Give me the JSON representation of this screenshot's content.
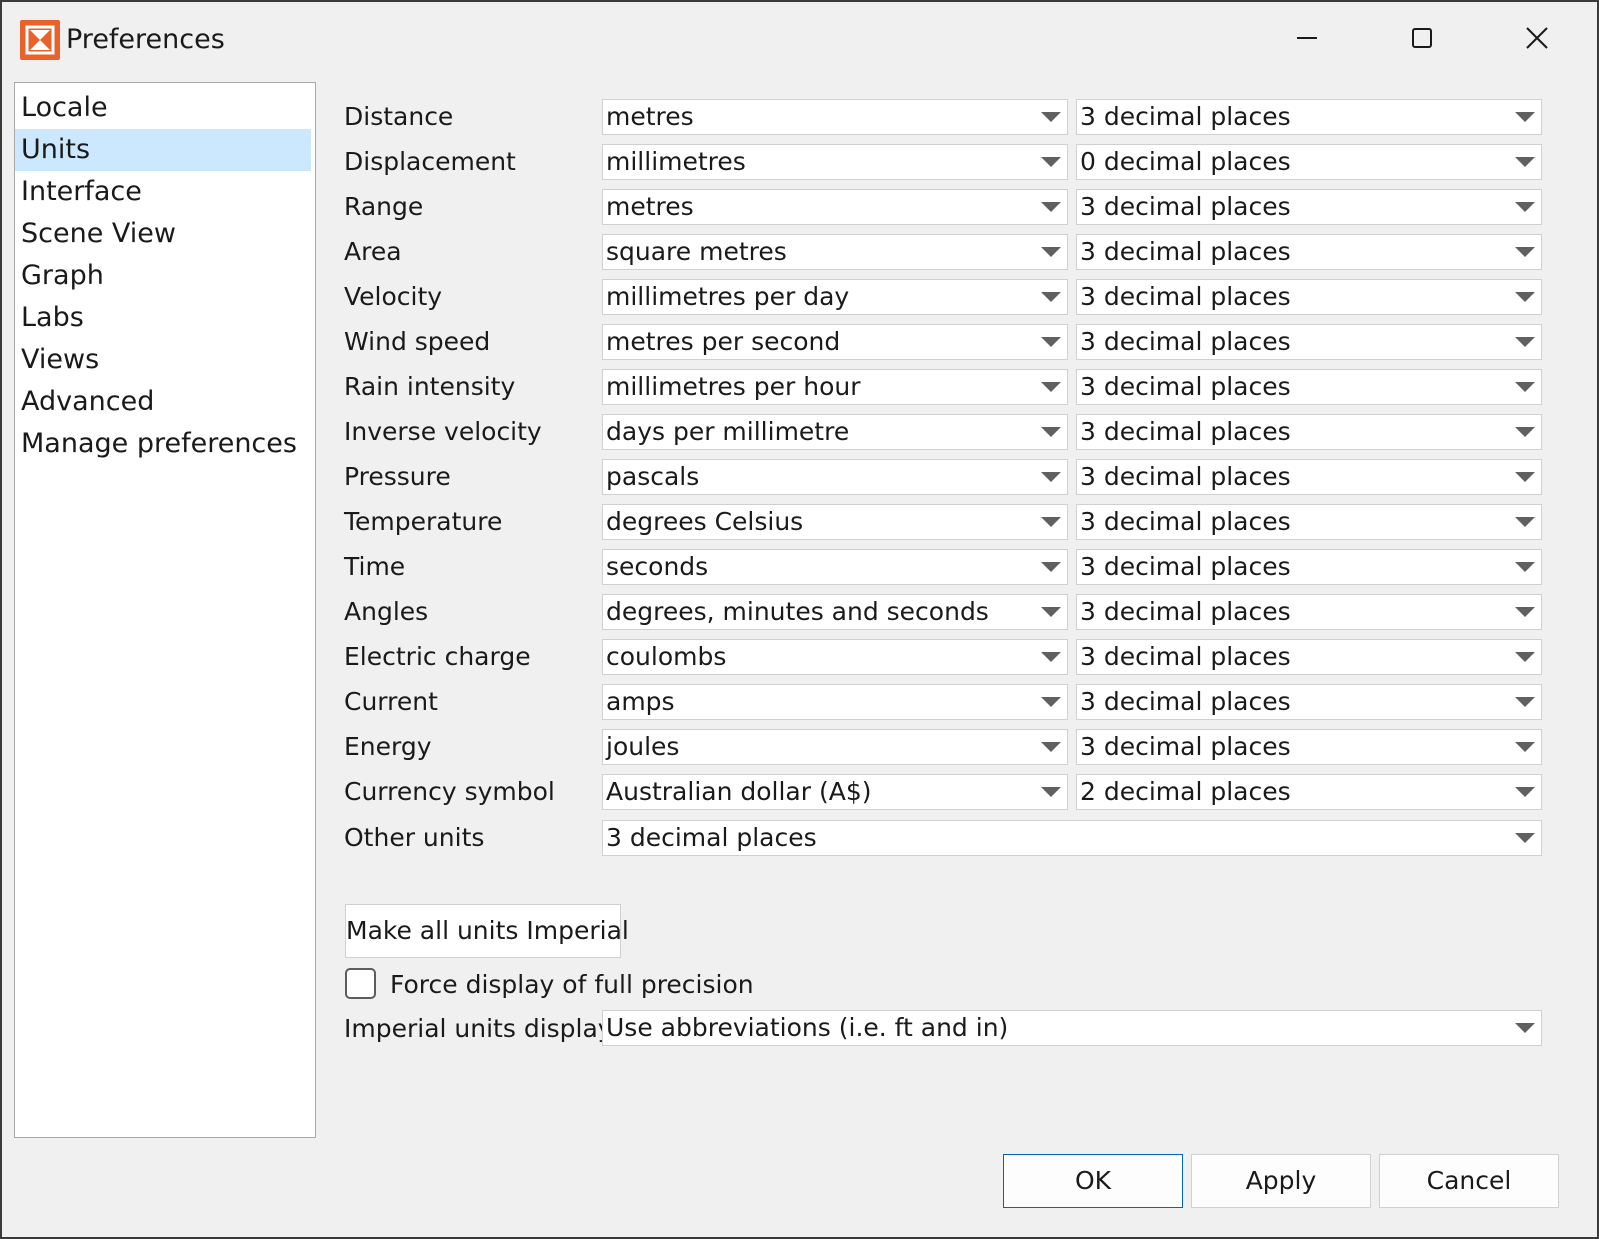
{
  "window": {
    "title": "Preferences",
    "app_icon": "app-logo-icon",
    "controls": [
      "minimize-icon",
      "maximize-icon",
      "close-icon"
    ]
  },
  "sidebar": {
    "items": [
      {
        "label": "Locale",
        "selected": false
      },
      {
        "label": "Units",
        "selected": true
      },
      {
        "label": "Interface",
        "selected": false
      },
      {
        "label": "Scene View",
        "selected": false
      },
      {
        "label": "Graph",
        "selected": false
      },
      {
        "label": "Labs",
        "selected": false
      },
      {
        "label": "Views",
        "selected": false
      },
      {
        "label": "Advanced",
        "selected": false
      },
      {
        "label": "Manage preferences",
        "selected": false
      }
    ]
  },
  "units": {
    "rows": [
      {
        "label": "Distance",
        "unit": "metres",
        "precision": "3 decimal places"
      },
      {
        "label": "Displacement",
        "unit": "millimetres",
        "precision": "0 decimal places"
      },
      {
        "label": "Range",
        "unit": "metres",
        "precision": "3 decimal places"
      },
      {
        "label": "Area",
        "unit": "square metres",
        "precision": "3 decimal places"
      },
      {
        "label": "Velocity",
        "unit": "millimetres per day",
        "precision": "3 decimal places"
      },
      {
        "label": "Wind speed",
        "unit": "metres per second",
        "precision": "3 decimal places"
      },
      {
        "label": "Rain intensity",
        "unit": "millimetres per hour",
        "precision": "3 decimal places"
      },
      {
        "label": "Inverse velocity",
        "unit": "days per millimetre",
        "precision": "3 decimal places"
      },
      {
        "label": "Pressure",
        "unit": "pascals",
        "precision": "3 decimal places"
      },
      {
        "label": "Temperature",
        "unit": "degrees Celsius",
        "precision": "3 decimal places"
      },
      {
        "label": "Time",
        "unit": "seconds",
        "precision": "3 decimal places"
      },
      {
        "label": "Angles",
        "unit": "degrees, minutes and seconds",
        "precision": "3 decimal places"
      },
      {
        "label": "Electric charge",
        "unit": "coulombs",
        "precision": "3 decimal places"
      },
      {
        "label": "Current",
        "unit": "amps",
        "precision": "3 decimal places"
      },
      {
        "label": "Energy",
        "unit": "joules",
        "precision": "3 decimal places"
      },
      {
        "label": "Currency symbol",
        "unit": "Australian dollar (A$)",
        "precision": "2 decimal places"
      }
    ],
    "other_units": {
      "label": "Other units",
      "precision": "3 decimal places"
    },
    "make_imperial_label": "Make all units Imperial",
    "force_precision": {
      "label": "Force display of full precision",
      "checked": false
    },
    "imperial_display": {
      "label": "Imperial units display",
      "value": "Use abbreviations (i.e. ft and in)"
    }
  },
  "footer": {
    "ok_label": "OK",
    "apply_label": "Apply",
    "cancel_label": "Cancel"
  },
  "colors": {
    "accent": "#0067c0",
    "selection": "#cce8ff",
    "app_icon": "#e8622c"
  }
}
